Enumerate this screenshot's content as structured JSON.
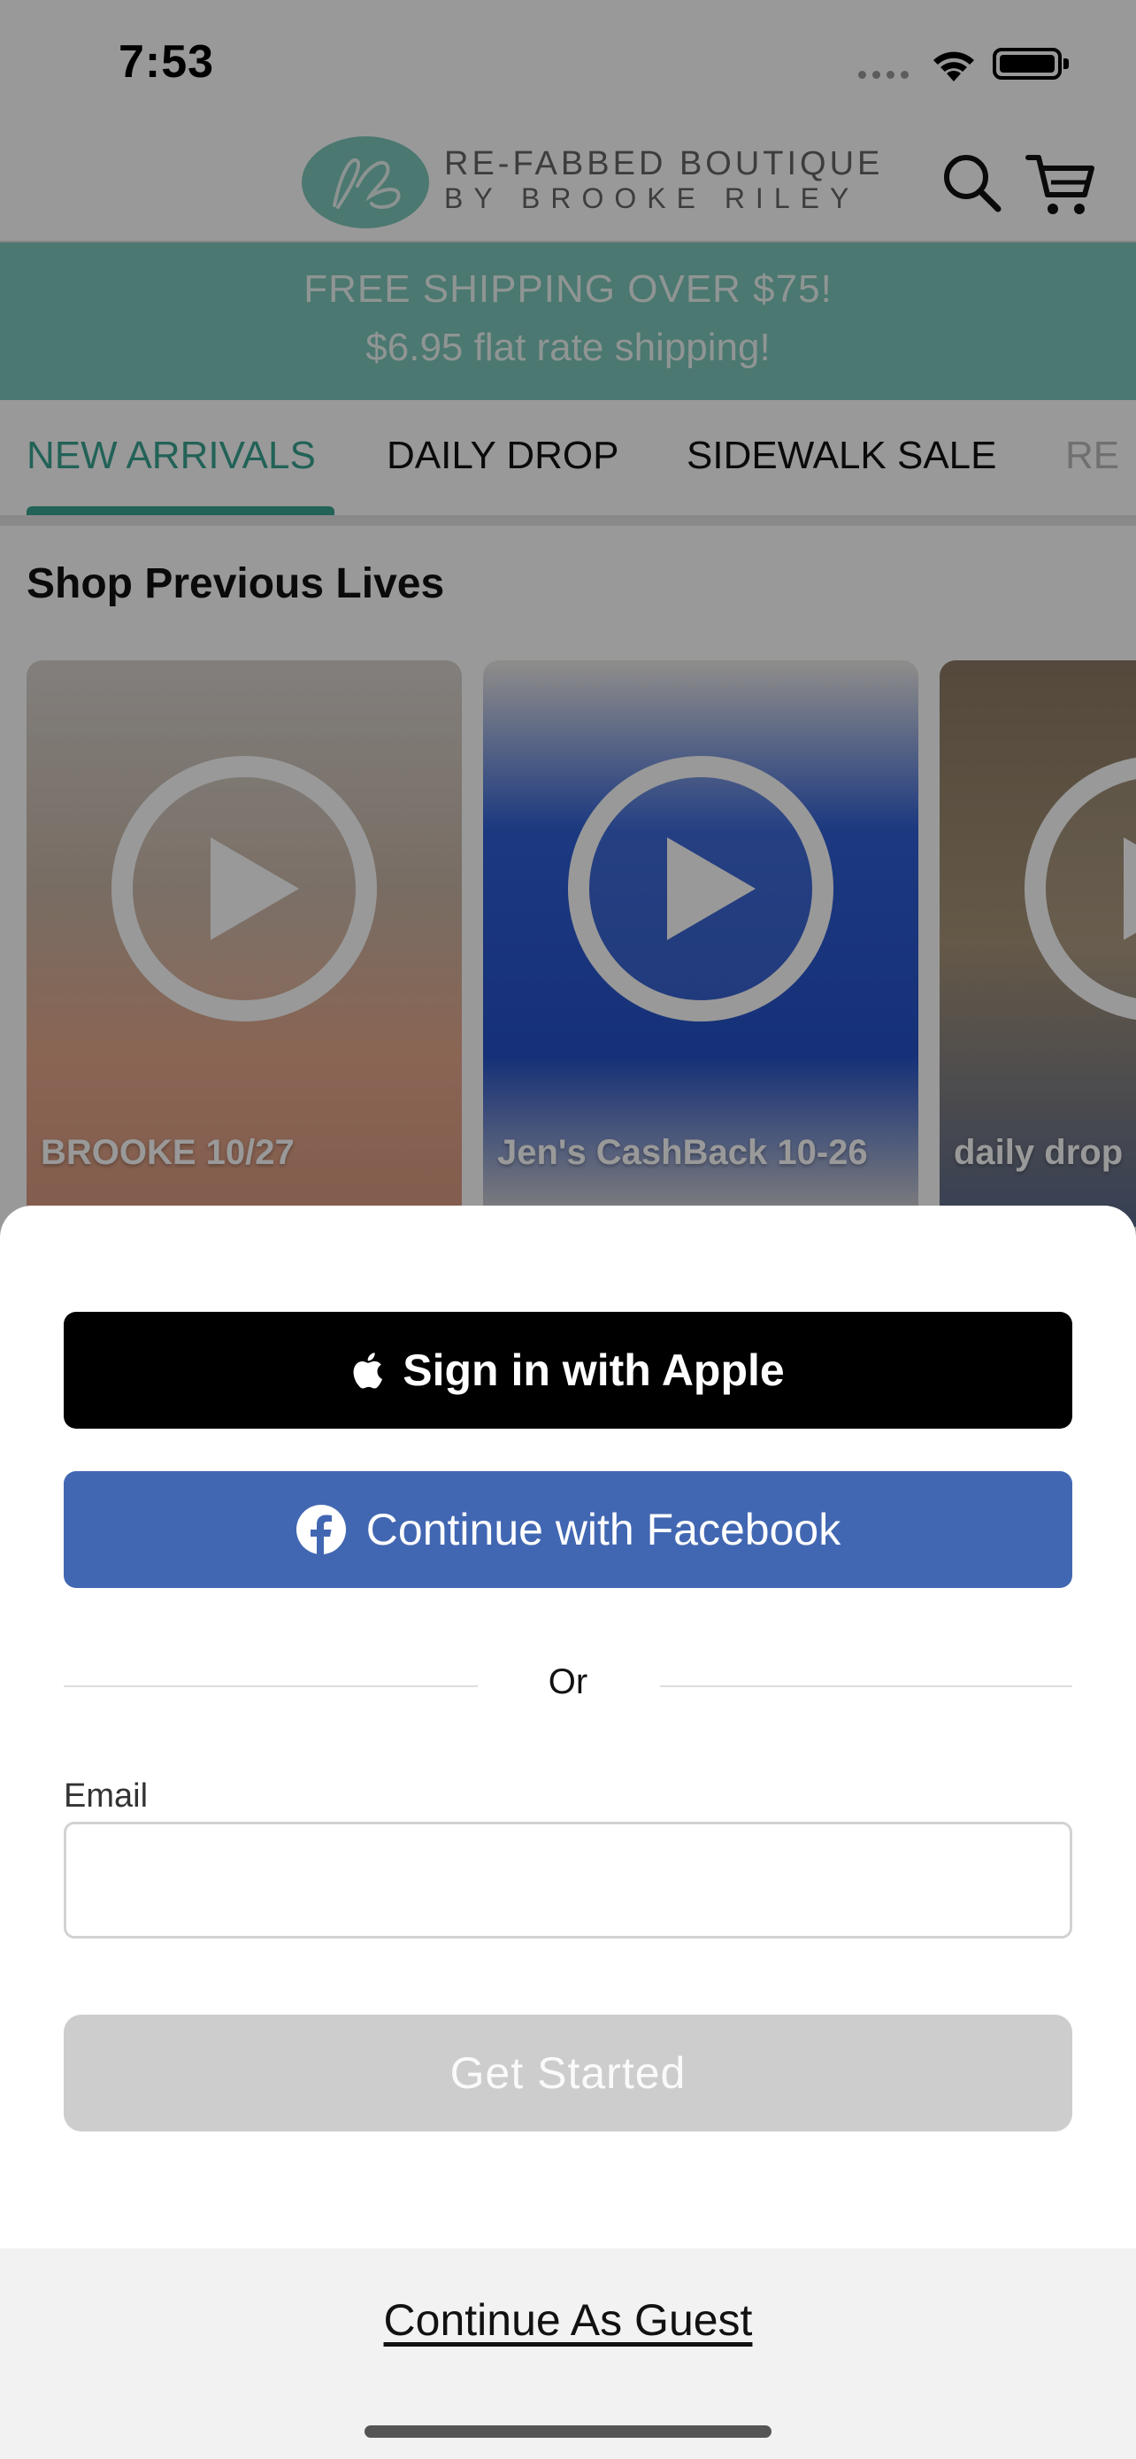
{
  "status_bar": {
    "time": "7:53"
  },
  "header": {
    "brand_line1": "RE-FABBED BOUTIQUE",
    "brand_line2": "BY BROOKE RILEY",
    "search_icon": "search-icon",
    "cart_icon": "cart-icon"
  },
  "banner": {
    "line1": "FREE SHIPPING OVER $75!",
    "line2": "$6.95 flat rate shipping!",
    "color": "#7dc9bb"
  },
  "tabs": [
    {
      "label": "NEW ARRIVALS"
    },
    {
      "label": "DAILY DROP"
    },
    {
      "label": "SIDEWALK SALE"
    },
    {
      "label": "RE"
    }
  ],
  "section": {
    "title": "Shop Previous Lives"
  },
  "cards": [
    {
      "title": "BROOKE 10/27"
    },
    {
      "title": "Jen's CashBack 10-26"
    },
    {
      "title": "daily drop"
    }
  ],
  "sheet": {
    "apple_label": "Sign in with Apple",
    "facebook_label": "Continue with Facebook",
    "or_label": "Or",
    "email_label": "Email",
    "email_value": "",
    "get_started_label": "Get Started",
    "guest_label": "Continue As Guest",
    "facebook_color": "#4267b2"
  },
  "colors": {
    "accent": "#3aa492"
  }
}
